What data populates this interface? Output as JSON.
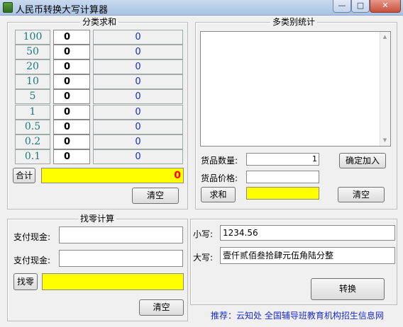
{
  "window": {
    "title": "人民币转换大写计算器",
    "minimize": "—",
    "maximize": "□",
    "close": "✕"
  },
  "classify": {
    "title": "分类求和",
    "rows": [
      {
        "denom": "100",
        "count": "0",
        "sum": "0"
      },
      {
        "denom": "50",
        "count": "0",
        "sum": "0"
      },
      {
        "denom": "20",
        "count": "0",
        "sum": "0"
      },
      {
        "denom": "10",
        "count": "0",
        "sum": "0"
      },
      {
        "denom": "5",
        "count": "0",
        "sum": "0"
      },
      {
        "denom": "1",
        "count": "0",
        "sum": "0"
      },
      {
        "denom": "0.5",
        "count": "0",
        "sum": "0"
      },
      {
        "denom": "0.2",
        "count": "0",
        "sum": "0"
      },
      {
        "denom": "0.1",
        "count": "0",
        "sum": "0"
      }
    ],
    "total_button": "合计",
    "total_value": "0",
    "clear_button": "清空"
  },
  "multi": {
    "title": "多类别统计",
    "qty_label": "货品数量:",
    "qty_value": "1",
    "price_label": "货品价格:",
    "price_value": "",
    "confirm_button": "确定加入",
    "sum_button": "求和",
    "sum_value": "",
    "clear_button": "清空"
  },
  "change": {
    "title": "找零计算",
    "pay1_label": "支付现金:",
    "pay1_value": "",
    "pay2_label": "支付现金:",
    "pay2_value": "",
    "change_button": "找零",
    "change_value": "",
    "clear_button": "清空"
  },
  "convert": {
    "lower_label": "小写:",
    "lower_value": "1234.56",
    "upper_label": "大写:",
    "upper_value": "壹仟贰佰叁拾肆元伍角陆分整",
    "convert_button": "转换"
  },
  "footer": "推荐：云知处 全国辅导班教育机构招生信息网",
  "colors": {
    "denomination_text": "#1a7c7a",
    "sum_text": "#1a2bd0",
    "total_text": "#ff0000",
    "highlight": "#ffff00",
    "footer_text": "#1a2bd0"
  }
}
